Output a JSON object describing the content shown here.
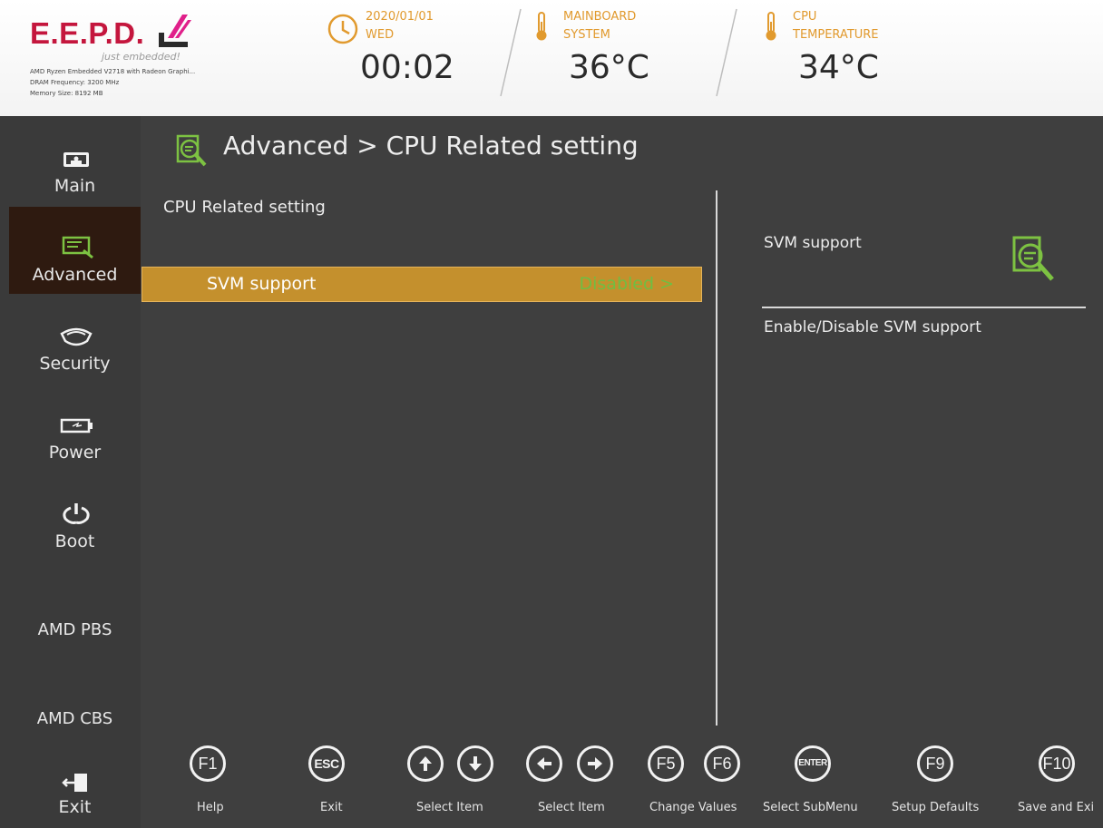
{
  "header": {
    "brand": "E.E.P.D.",
    "tagline": "just embedded!",
    "system_info": [
      "AMD Ryzen Embedded V2718 with Radeon Graphi...",
      "DRAM Frequency: 3200 MHz",
      "Memory Size: 8192 MB"
    ],
    "date": "2020/01/01",
    "weekday": "WED",
    "time": "00:02",
    "mainboard_label_1": "MAINBOARD",
    "mainboard_label_2": "SYSTEM",
    "mainboard_temp": "36°C",
    "cpu_label_1": "CPU",
    "cpu_label_2": "TEMPERATURE",
    "cpu_temp": "34°C",
    "accent_color": "#e19a2e",
    "brand_color": "#c4163d"
  },
  "sidebar": {
    "items": [
      {
        "label": "Main",
        "icon": "monitor-icon"
      },
      {
        "label": "Advanced",
        "icon": "advanced-icon",
        "active": true
      },
      {
        "label": "Security",
        "icon": "shield-icon"
      },
      {
        "label": "Power",
        "icon": "battery-icon"
      },
      {
        "label": "Boot",
        "icon": "power-cycle-icon"
      },
      {
        "label": "AMD PBS"
      },
      {
        "label": "AMD CBS"
      },
      {
        "label": "Exit",
        "icon": "exit-icon"
      }
    ]
  },
  "main": {
    "breadcrumb": "Advanced > CPU Related setting",
    "section_title": "CPU Related setting",
    "settings": [
      {
        "name": "SVM support",
        "value": "Disabled >",
        "selected": true
      }
    ],
    "highlight_color": "#c4902d",
    "value_color": "#6fbe43"
  },
  "help": {
    "title": "SVM support",
    "description": "Enable/Disable SVM support",
    "icon": "advanced-icon"
  },
  "footer": {
    "keys": [
      {
        "keys": [
          "F1"
        ],
        "desc": "Help"
      },
      {
        "keys": [
          "ESC"
        ],
        "desc": "Exit"
      },
      {
        "keys": [
          "arrow-up-icon",
          "arrow-down-icon"
        ],
        "desc": "Select Item"
      },
      {
        "keys": [
          "arrow-left-icon",
          "arrow-right-icon"
        ],
        "desc": "Select Item"
      },
      {
        "keys": [
          "F5",
          "F6"
        ],
        "desc": "Change Values"
      },
      {
        "keys": [
          "ENTER"
        ],
        "desc": "Select SubMenu"
      },
      {
        "keys": [
          "F9"
        ],
        "desc": "Setup Defaults"
      },
      {
        "keys": [
          "F10"
        ],
        "desc": "Save and Exi"
      }
    ]
  }
}
